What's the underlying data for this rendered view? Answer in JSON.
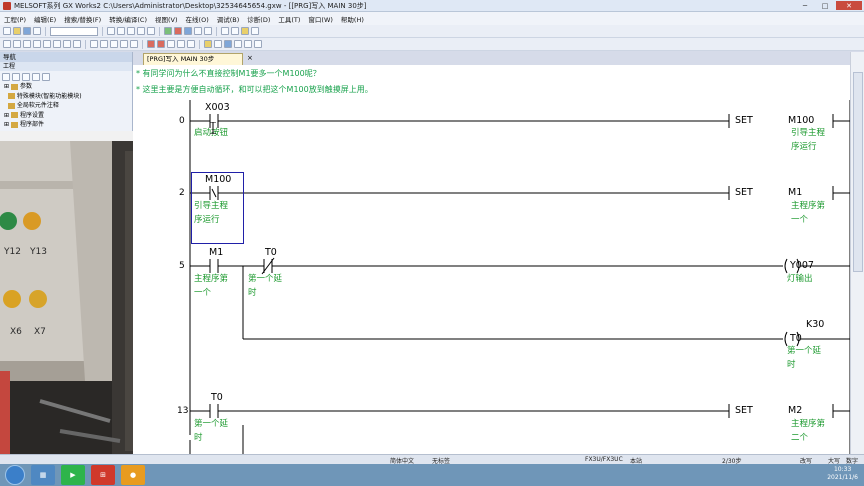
{
  "window": {
    "title": "MELSOFT系列 GX Works2 C:\\Users\\Administrator\\Desktop\\32534645654.gxw - [[PRG]写入 MAIN 30步]"
  },
  "menu": [
    "工程(P)",
    "编辑(E)",
    "搜索/替换(F)",
    "转换/编译(C)",
    "视图(V)",
    "在线(O)",
    "调试(B)",
    "诊断(D)",
    "工具(T)",
    "窗口(W)",
    "帮助(H)"
  ],
  "nav": {
    "header": "导航",
    "subheader": "工程",
    "items": [
      "参数",
      "特殊模块(智能功能模块)",
      "全局软元件注释",
      "程序设置",
      "程序部件"
    ]
  },
  "tab": {
    "label": "[PRG]写入 MAIN 30步",
    "close": "×"
  },
  "comments": [
    "有同学问为什么不直接控制M1要多一个M100呢？",
    "这里主要是方便自动循环，和可以把这个M100放到触摸屏上用。"
  ],
  "rungs": [
    {
      "step": "0",
      "contacts": [
        {
          "addr": "X003",
          "comment": "启动按钮",
          "type": "NO"
        }
      ],
      "instruction": "SET",
      "device": "M100",
      "device_comment": [
        "引导主程",
        "序运行"
      ]
    },
    {
      "step": "2",
      "contacts": [
        {
          "addr": "M100",
          "comment": [
            "引导主程",
            "序运行"
          ],
          "type": "NO"
        }
      ],
      "instruction": "SET",
      "device": "M1",
      "device_comment": [
        "主程序第",
        "一个"
      ]
    },
    {
      "step": "5",
      "contacts": [
        {
          "addr": "M1",
          "comment": [
            "主程序第",
            "一个"
          ],
          "type": "NO"
        },
        {
          "addr": "T0",
          "comment": [
            "第一个延",
            "时"
          ],
          "type": "NC"
        }
      ],
      "coil": "Y007",
      "coil_comment": "灯输出",
      "branch_coil": "T0",
      "branch_const": "K30",
      "branch_comment": [
        "第一个延",
        "时"
      ]
    },
    {
      "step": "13",
      "contacts": [
        {
          "addr": "T0",
          "comment": [
            "第一个延",
            "时"
          ],
          "type": "NO"
        }
      ],
      "instruction": "SET",
      "device": "M2",
      "device_comment": [
        "主程序第",
        "二个"
      ]
    }
  ],
  "video": {
    "labels": [
      "Y12",
      "Y13",
      "X6",
      "X7"
    ]
  },
  "status": {
    "language": "简体中文",
    "label": "无标签",
    "plc": "FX3U/FX3UC",
    "station": "本站",
    "steps": "2/30步",
    "mode": "改写",
    "size": "大写",
    "num": "数字"
  },
  "clock": {
    "time": "10:33",
    "date": "2021/11/6"
  },
  "colors": {
    "comment_green": "#19a24d",
    "cursor_blue": "#2020a8"
  }
}
